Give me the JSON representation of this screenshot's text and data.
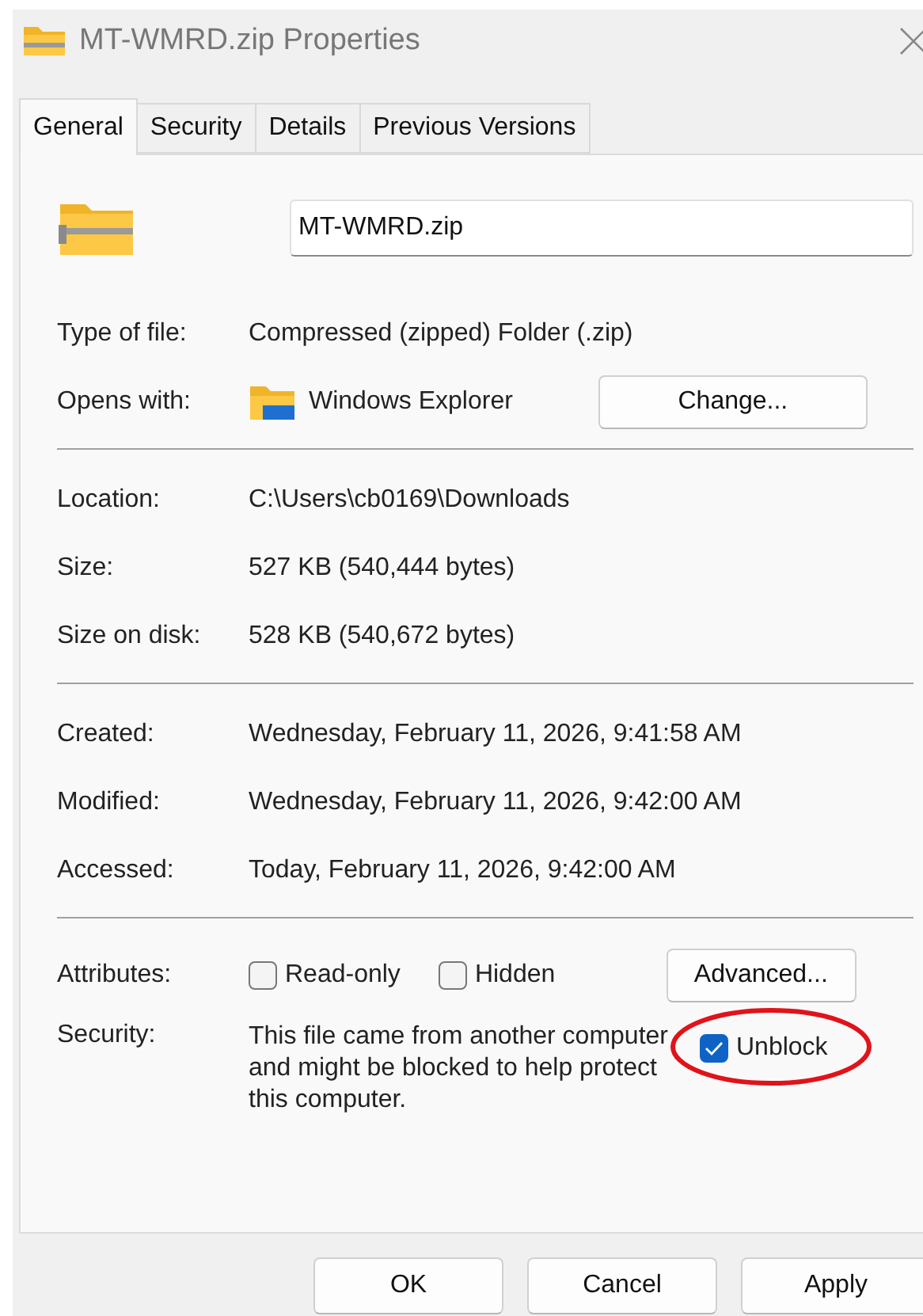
{
  "window": {
    "title": "MT-WMRD.zip Properties"
  },
  "tabs": [
    {
      "label": "General",
      "selected": true
    },
    {
      "label": "Security",
      "selected": false
    },
    {
      "label": "Details",
      "selected": false
    },
    {
      "label": "Previous Versions",
      "selected": false
    }
  ],
  "name_field": {
    "value": "MT-WMRD.zip"
  },
  "sections": [
    [
      {
        "kind": "text",
        "label": "Type of file:",
        "value": "Compressed (zipped) Folder (.zip)"
      },
      {
        "kind": "app",
        "label": "Opens with:",
        "value": "Windows Explorer",
        "button": "Change..."
      }
    ],
    [
      {
        "kind": "text",
        "label": "Location:",
        "value": "C:\\Users\\cb0169\\Downloads"
      },
      {
        "kind": "text",
        "label": "Size:",
        "value": "527 KB (540,444 bytes)"
      },
      {
        "kind": "text",
        "label": "Size on disk:",
        "value": "528 KB (540,672 bytes)"
      }
    ],
    [
      {
        "kind": "text",
        "label": "Created:",
        "value": "Wednesday, February 11, 2026, 9:41:58 AM"
      },
      {
        "kind": "text",
        "label": "Modified:",
        "value": "Wednesday, February 11, 2026, 9:42:00 AM"
      },
      {
        "kind": "text",
        "label": "Accessed:",
        "value": "Today, February 11, 2026, 9:42:00 AM"
      }
    ]
  ],
  "attributes": {
    "label": "Attributes:",
    "checkboxes": [
      {
        "label": "Read-only",
        "checked": false
      },
      {
        "label": "Hidden",
        "checked": false
      }
    ],
    "button": "Advanced..."
  },
  "security": {
    "label": "Security:",
    "text": "This file came from another computer and might be blocked to help protect this computer.",
    "unblock": {
      "label": "Unblock",
      "checked": true,
      "highlighted": true
    }
  },
  "buttons": [
    "OK",
    "Cancel",
    "Apply"
  ]
}
